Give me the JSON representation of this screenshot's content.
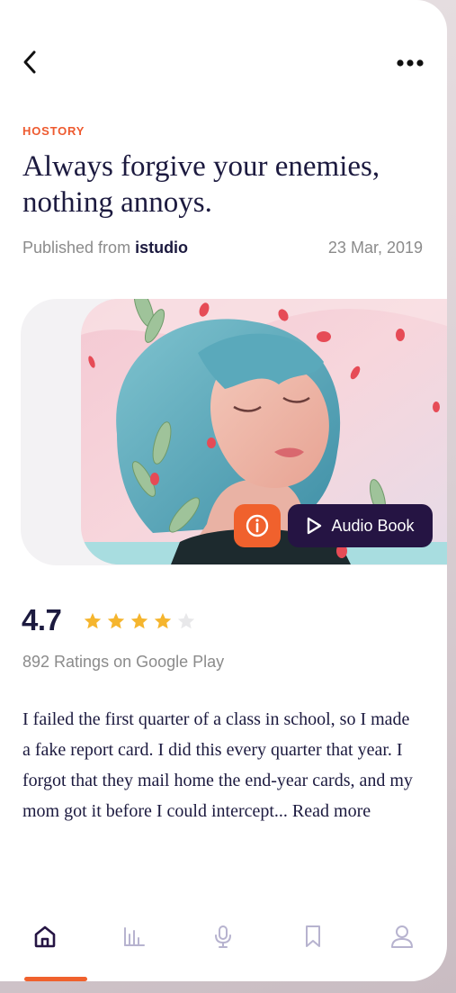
{
  "article": {
    "category": "HOSTORY",
    "title": "Always forgive your enemies, nothing annoys.",
    "published_prefix": "Published from ",
    "publisher": "istudio",
    "date": "23 Mar, 2019"
  },
  "hero": {
    "image_description": "illustration-woman-blue-hair-petals",
    "info_icon": "info-circle-icon",
    "audio_icon": "play-outline-icon",
    "audio_label": "Audio Book"
  },
  "rating": {
    "value": "4.7",
    "stars_filled": 4,
    "stars_total": 5,
    "count_label": "892 Ratings on Google Play"
  },
  "excerpt": {
    "text": "I failed the first quarter of a class in school, so I made a fake report card. I did this every quarter that year. I forgot that they mail home the end-year cards, and my mom got it before I could intercept... ",
    "read_more": "Read more"
  },
  "nav": {
    "items": [
      {
        "icon": "home-icon",
        "active": true
      },
      {
        "icon": "stats-icon",
        "active": false
      },
      {
        "icon": "microphone-icon",
        "active": false
      },
      {
        "icon": "bookmark-icon",
        "active": false
      },
      {
        "icon": "profile-icon",
        "active": false
      }
    ]
  },
  "colors": {
    "accent": "#f0612d",
    "dark": "#251443",
    "star": "#f5b52e",
    "star_empty": "#e8e8ea",
    "nav_inactive": "#b7b3cf"
  }
}
